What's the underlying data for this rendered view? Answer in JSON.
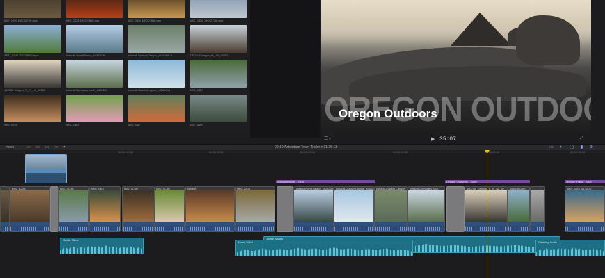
{
  "browser": {
    "thumbnails": [
      {
        "caption": "IMG_1200 DSC08765.mov",
        "colors": [
          "#3b3226",
          "#6b5a40"
        ]
      },
      {
        "caption": "IMG_2201 DSC07865.mov",
        "colors": [
          "#2a1a10",
          "#b8401a"
        ]
      },
      {
        "caption": "IMG_2305 DSC07866.mov",
        "colors": [
          "#3a2a1a",
          "#c89850"
        ]
      },
      {
        "caption": "IMG_2306 DSC07741.mov",
        "colors": [
          "#7a8fa8",
          "#c0c8d0"
        ]
      },
      {
        "caption": "ASTI_0740 DSC08852.mov",
        "colors": [
          "#8eb0d6",
          "#4f7a3a"
        ]
      },
      {
        "caption": "Iceland-North Beach_s026203a",
        "colors": [
          "#b5cde6",
          "#5a7a8a"
        ]
      },
      {
        "caption": "Iceland-Fjadrar Canyon_s0264632a",
        "colors": [
          "#6b7f6a",
          "#9aa8a4"
        ]
      },
      {
        "caption": "SS0291 Oregon_ib_JRI_00001",
        "colors": [
          "#c9d2da",
          "#4a3c30"
        ]
      },
      {
        "caption": "160705 Oregon_Ti_iP_n2_00000",
        "colors": [
          "#e2d6c2",
          "#3a3836"
        ]
      },
      {
        "caption": "Iceland-Dyrholaey Arch_s006400",
        "colors": [
          "#c8d6e0",
          "#5b6f4c"
        ]
      },
      {
        "caption": "Iceland-Glacier Lagoon_s006a06b",
        "colors": [
          "#8eb8d6",
          "#cfe0ea"
        ]
      },
      {
        "caption": "IMG_0872",
        "colors": [
          "#4a6a3a",
          "#8fa0a8"
        ]
      },
      {
        "caption": "IMG_0756",
        "colors": [
          "#3a2a1a",
          "#c89060"
        ]
      },
      {
        "caption": "IMG_0453",
        "colors": [
          "#6fa04a",
          "#e59ab8"
        ]
      },
      {
        "caption": "IMG_0367",
        "colors": [
          "#5f7f5a",
          "#d26a3a"
        ]
      },
      {
        "caption": "IMG_0830",
        "colors": [
          "#7a8a8a",
          "#3a4a3a"
        ]
      }
    ]
  },
  "viewer": {
    "big_title": "OREGON OUTDOORS",
    "title": "Oregon Outdoors",
    "timecode": "35:07",
    "play_icon": "play-icon"
  },
  "toolbar": {
    "index_label": "Index",
    "project_title": "00:10 Adventure Team Trailer ▾  01:35:11"
  },
  "ruler": [
    "00:00:10:00",
    "00:00:15:00",
    "00:00:20:00",
    "00:00:25:00",
    "00:00:30:00",
    "00:00:35:00"
  ],
  "timeline": {
    "titles": [
      {
        "label": "Iceland Kayak - Echo"
      },
      {
        "label": "Oregon Outdoors - Echo"
      },
      {
        "label": "Oregon Trails - Echo"
      }
    ],
    "clips": [
      {
        "label": "",
        "colors": [
          "#6b5a45",
          "#3a3026"
        ]
      },
      {
        "label": "DSC_1234",
        "colors": [
          "#8a6a4a",
          "#4a3a2a"
        ]
      },
      {
        "label": "IMG_0733",
        "colors": [
          "#5a7a4a",
          "#8a9aa8"
        ]
      },
      {
        "label": "IMG_0367",
        "colors": [
          "#3a4a3a",
          "#d8904a"
        ]
      },
      {
        "label": "IMG_0728",
        "colors": [
          "#3a3226",
          "#a06a3a"
        ]
      },
      {
        "label": "IMG_0734",
        "colors": [
          "#6a8a3a",
          "#d8c8a8"
        ]
      },
      {
        "label": "Iceland",
        "colors": [
          "#5a3a2a",
          "#c88a4a"
        ]
      },
      {
        "label": "IMG_2235",
        "colors": [
          "#7a6a3a",
          "#a8a8a8"
        ]
      },
      {
        "label": "Iceland-North Beach_s026203",
        "colors": [
          "#b8cce0",
          "#3a4a4a"
        ]
      },
      {
        "label": "Iceland-Glacier Lagoon_s006a06",
        "colors": [
          "#a8c8e0",
          "#dfe8ef"
        ]
      },
      {
        "label": "Iceland-Fjadrar Canyon",
        "colors": [
          "#7a8a6a",
          "#5a6a5a"
        ]
      },
      {
        "label": "Iceland-Dyrholaey Arch",
        "colors": [
          "#c8d6e0",
          "#5b6f4c"
        ]
      },
      {
        "label": "160705_Oregon_Ti_iP_n2_00",
        "colors": [
          "#d8cdb8",
          "#3a3836"
        ]
      },
      {
        "label": "Iceland-Dyrh",
        "colors": [
          "#8fb0c8",
          "#4a6a3a"
        ]
      },
      {
        "label": "",
        "colors": [
          "#a8a8a8",
          "#6a6a6a"
        ]
      },
      {
        "label": "IMG_0453_01.MOV",
        "colors": [
          "#3a6a8a",
          "#d8a060"
        ]
      }
    ],
    "audio": [
      {
        "label": "Gentle Tides"
      },
      {
        "label": "Ocean Waves"
      },
      {
        "label": "Forest Wind"
      },
      {
        "label": "Climbing Audio"
      }
    ]
  }
}
